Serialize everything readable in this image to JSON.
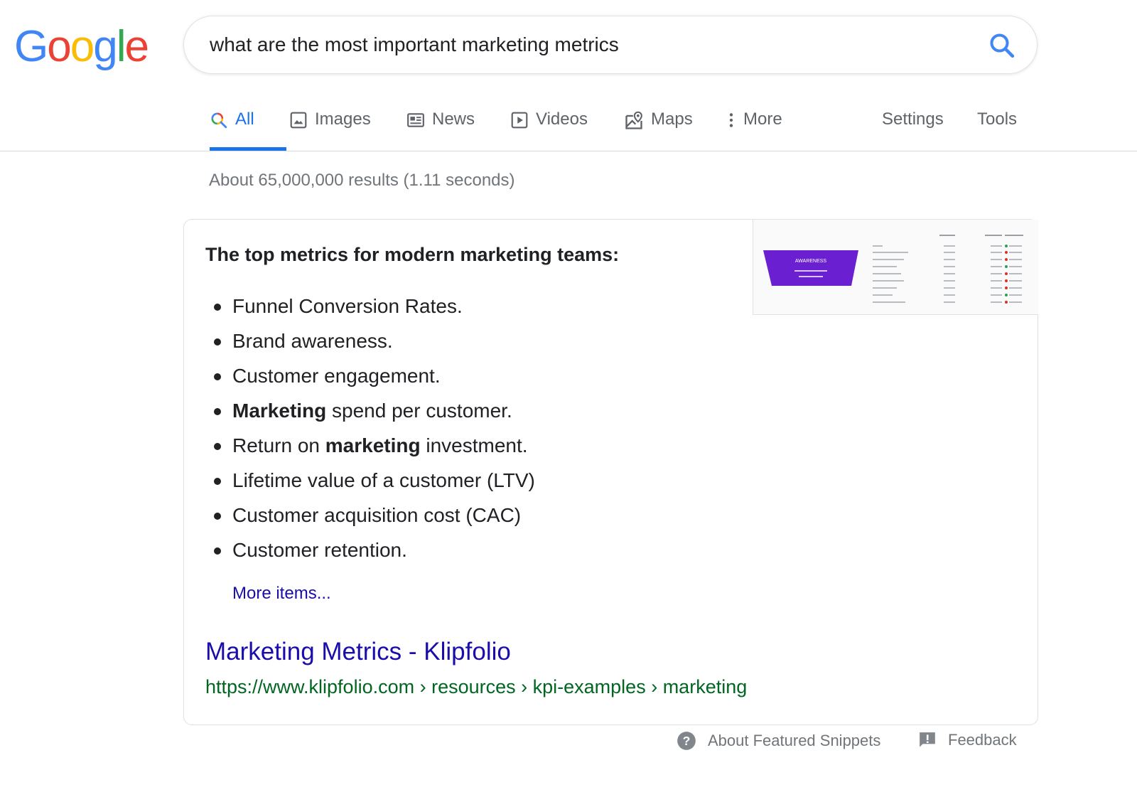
{
  "logo": {
    "letters": [
      "G",
      "o",
      "o",
      "g",
      "l",
      "e"
    ],
    "colors": [
      "#4285F4",
      "#EA4335",
      "#FBBC05",
      "#4285F4",
      "#34A853",
      "#EA4335"
    ]
  },
  "search": {
    "query": "what are the most important marketing metrics",
    "button_icon": "search-icon"
  },
  "tabs": [
    {
      "label": "All",
      "icon": "search-icon",
      "active": true
    },
    {
      "label": "Images",
      "icon": "image-icon"
    },
    {
      "label": "News",
      "icon": "news-icon"
    },
    {
      "label": "Videos",
      "icon": "video-icon"
    },
    {
      "label": "Maps",
      "icon": "map-pin-icon"
    },
    {
      "label": "More",
      "icon": "more-vert-icon"
    },
    {
      "label": "Settings"
    },
    {
      "label": "Tools"
    }
  ],
  "result_stats": "About 65,000,000 results (1.11 seconds)",
  "snippet": {
    "heading": "The top metrics for modern marketing teams:",
    "items": [
      [
        {
          "t": "Funnel Conversion Rates."
        }
      ],
      [
        {
          "t": "Brand awareness."
        }
      ],
      [
        {
          "t": "Customer engagement."
        }
      ],
      [
        {
          "t": "Marketing",
          "b": true
        },
        {
          "t": " spend per customer."
        }
      ],
      [
        {
          "t": "Return on "
        },
        {
          "t": "marketing",
          "b": true
        },
        {
          "t": " investment."
        }
      ],
      [
        {
          "t": "Lifetime value of a customer (LTV)"
        }
      ],
      [
        {
          "t": "Customer acquisition cost (CAC)"
        }
      ],
      [
        {
          "t": "Customer retention."
        }
      ]
    ],
    "more_items": "More items...",
    "result_title": "Marketing Metrics - Klipfolio",
    "result_url": "https://www.klipfolio.com › resources › kpi-examples › marketing",
    "thumbnail": {
      "funnel_label": "AWARENESS",
      "funnel_color": "#6a1fd0"
    }
  },
  "footer": {
    "about_label": "About Featured Snippets",
    "feedback_label": "Feedback"
  },
  "colors": {
    "link": "#1a0dab",
    "url_green": "#006621",
    "accent_blue": "#1a73e8",
    "muted": "#70757a"
  }
}
